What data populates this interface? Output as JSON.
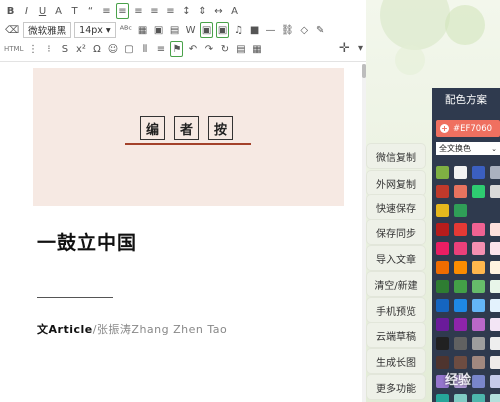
{
  "toolbar": {
    "font_family": "微软雅黑",
    "font_size": "14px",
    "html_label": "HTML"
  },
  "article": {
    "cover_chars": [
      "编",
      "者",
      "按"
    ],
    "headline": "一鼓立中国",
    "byline_bold": "文Article",
    "byline_rest": "/张振涛Zhang Zhen Tao"
  },
  "actions": [
    "微信复制",
    "外网复制",
    "快速保存",
    "保存同步",
    "导入文章",
    "清空/新建",
    "手机预览",
    "云端草稿",
    "生成长图",
    "更多功能"
  ],
  "color_panel": {
    "title": "配色方案",
    "current_hex": "#EF7060",
    "plus_icon": "+",
    "mode_select": "全文换色",
    "caret": "⌄",
    "swatches": [
      "#7fb043",
      "#f2f2f2",
      "#3b5fc0",
      "#aab1c0",
      "#c0392b",
      "#e8735f",
      "#2ecc71",
      "#d9d9d9",
      "#e6b81d",
      "#2f9e57",
      "",
      "",
      "#b71c1c",
      "#e53935",
      "#f06292",
      "#fde0dc",
      "#e91e63",
      "#ec407a",
      "#f48fb1",
      "#fce4ec",
      "#ef6c00",
      "#fb8c00",
      "#ffb74d",
      "#fff3e0",
      "#2e7d32",
      "#43a047",
      "#66bb6a",
      "#e8f5e9",
      "#1565c0",
      "#1e88e5",
      "#64b5f6",
      "#e3f2fd",
      "#6a1b9a",
      "#8e24aa",
      "#ba68c8",
      "#f3e5f5",
      "#212121",
      "#616161",
      "#9e9e9e",
      "#eeeeee",
      "#4e342e",
      "#6d4c41",
      "#a1887f",
      "#efebe9",
      "#9575cd",
      "#b39ddb",
      "#7986cb",
      "#c5cae9",
      "#26a69a",
      "#80cbc4",
      "#4db6ac",
      "#b2dfdb"
    ]
  },
  "watermark": "经验"
}
